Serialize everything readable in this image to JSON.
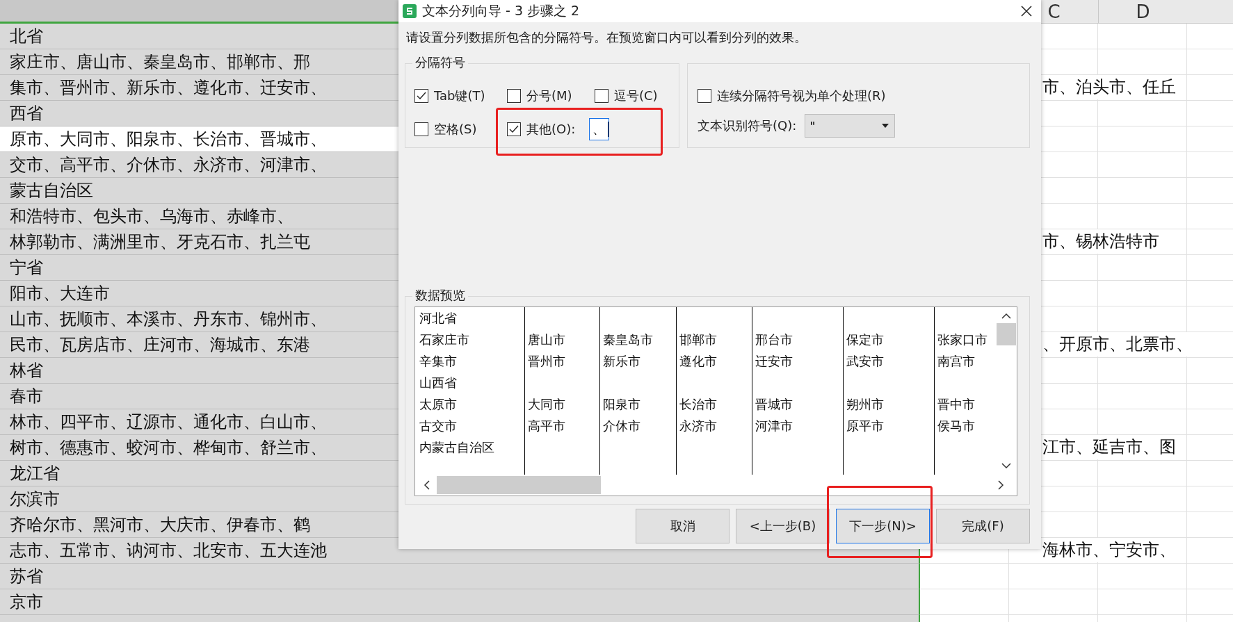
{
  "sheet": {
    "columns": [
      "C",
      "D"
    ],
    "rows": [
      {
        "text": "北省",
        "highlighted": false
      },
      {
        "text": "家庄市、唐山市、秦皇岛市、邯郸市、邢",
        "highlighted": false
      },
      {
        "text": "集市、晋州市、新乐市、遵化市、迁安市、",
        "overflow": "市、泊头市、任丘",
        "highlighted": false
      },
      {
        "text": "西省",
        "highlighted": false
      },
      {
        "text": "原市、大同市、阳泉市、长治市、晋城市、",
        "highlighted": true
      },
      {
        "text": "交市、高平市、介休市、永济市、河津市、",
        "highlighted": false
      },
      {
        "text": "蒙古自治区",
        "highlighted": false
      },
      {
        "text": "和浩特市、包头市、乌海市、赤峰市、",
        "highlighted": false
      },
      {
        "text": "林郭勒市、满洲里市、牙克石市、扎兰屯",
        "overflow": "市、锡林浩特市",
        "highlighted": false
      },
      {
        "text": "宁省",
        "highlighted": false
      },
      {
        "text": "阳市、大连市",
        "highlighted": false
      },
      {
        "text": "山市、抚顺市、本溪市、丹东市、锦州市、",
        "highlighted": false
      },
      {
        "text": "民市、瓦房店市、庄河市、海城市、东港",
        "overflow": "、开原市、北票市、",
        "highlighted": false
      },
      {
        "text": "林省",
        "highlighted": false
      },
      {
        "text": "春市",
        "highlighted": false
      },
      {
        "text": "林市、四平市、辽源市、通化市、白山市、",
        "highlighted": false
      },
      {
        "text": "树市、德惠市、蛟河市、桦甸市、舒兰市、",
        "overflow": "江市、延吉市、图",
        "highlighted": false
      },
      {
        "text": "龙江省",
        "highlighted": false
      },
      {
        "text": "尔滨市",
        "highlighted": false
      },
      {
        "text": "齐哈尔市、黑河市、大庆市、伊春市、鹤",
        "highlighted": false
      },
      {
        "text": "志市、五常市、讷河市、北安市、五大连池",
        "overflow": "海林市、宁安市、",
        "highlighted": false
      },
      {
        "text": "苏省",
        "highlighted": false
      },
      {
        "text": "京市",
        "highlighted": false
      }
    ]
  },
  "dialog": {
    "title": "文本分列向导 - 3 步骤之 2",
    "instruction": "请设置分列数据所包含的分隔符号。在预览窗口内可以看到分列的效果。",
    "delimiters": {
      "title": "分隔符号",
      "options": [
        {
          "kind": "checkbox",
          "label": "Tab键(T)",
          "checked": true
        },
        {
          "kind": "checkbox",
          "label": "分号(M)",
          "checked": false
        },
        {
          "kind": "checkbox",
          "label": "逗号(C)",
          "checked": false
        },
        {
          "kind": "checkbox",
          "label": "空格(S)",
          "checked": false
        },
        {
          "kind": "field",
          "label": "其他(O):",
          "checked": true,
          "value": "、"
        }
      ]
    },
    "consecutive": {
      "label": "连续分隔符号视为单个处理(R)",
      "checked": false
    },
    "qualifier": {
      "label": "文本识别符号(Q):",
      "value": "\""
    },
    "preview": {
      "title": "数据预览",
      "rows": [
        [
          "河北省"
        ],
        [
          "石家庄市",
          "唐山市",
          "秦皇岛市",
          "邯郸市",
          "邢台市",
          "保定市",
          "张家口市"
        ],
        [
          "辛集市",
          "晋州市",
          "新乐市",
          "遵化市",
          "迁安市",
          "武安市",
          "南宫市"
        ],
        [
          "山西省"
        ],
        [
          "太原市",
          "大同市",
          "阳泉市",
          "长治市",
          "晋城市",
          "朔州市",
          "晋中市"
        ],
        [
          "古交市",
          "高平市",
          "介休市",
          "永济市",
          "河津市",
          "原平市",
          "侯马市"
        ],
        [
          "内蒙古自治区"
        ]
      ]
    },
    "buttons": [
      {
        "label": "取消",
        "focused": false
      },
      {
        "label": "<上一步(B)",
        "focused": false
      },
      {
        "label": "下一步(N)>",
        "focused": true
      },
      {
        "label": "完成(F)",
        "focused": false
      }
    ]
  }
}
